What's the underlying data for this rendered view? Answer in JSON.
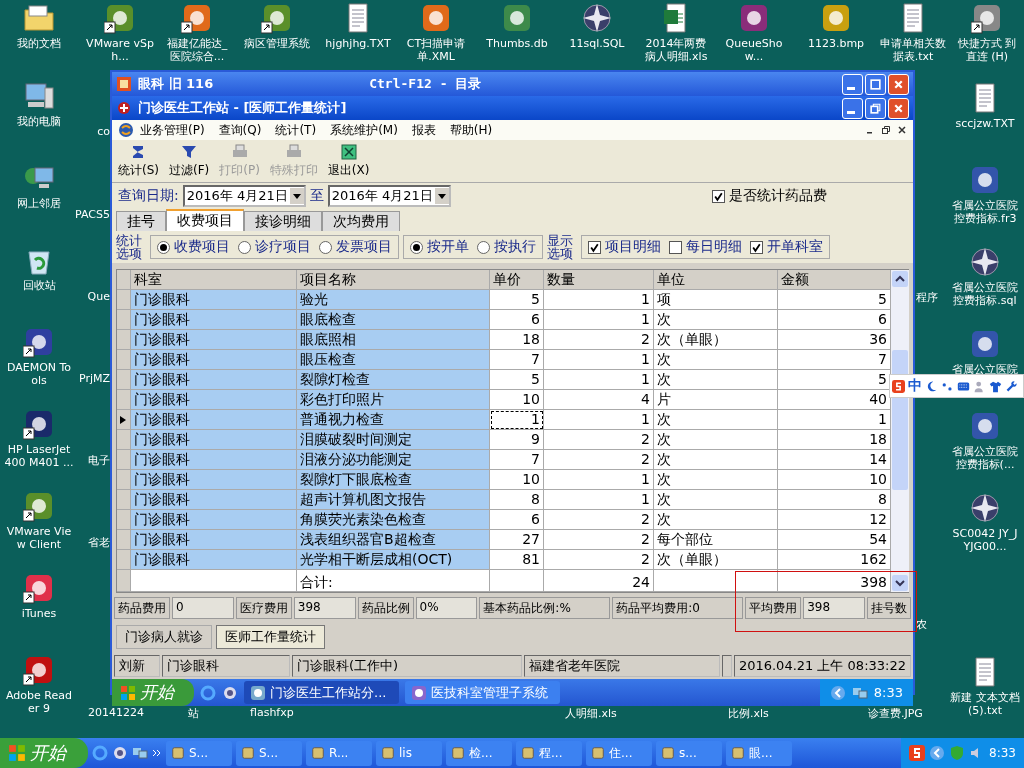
{
  "desktop": {
    "top_icons": [
      {
        "label": "我的文档",
        "kind": "folder",
        "shortcut": false
      },
      {
        "label": "VMware vSph...",
        "kind": "app",
        "shortcut": true
      },
      {
        "label": "福建亿能达_医院综合...",
        "kind": "web",
        "shortcut": true
      },
      {
        "label": "病区管理系统",
        "kind": "app",
        "shortcut": true
      },
      {
        "label": "hjghjhg.TXT",
        "kind": "text",
        "shortcut": false
      },
      {
        "label": "CT扫描申请单.XML",
        "kind": "web",
        "shortcut": false
      },
      {
        "label": "Thumbs.db",
        "kind": "db",
        "shortcut": false
      },
      {
        "label": "11sql.SQL",
        "kind": "compass",
        "shortcut": false
      },
      {
        "label": "2014年两费病人明细.xls",
        "kind": "sheet",
        "shortcut": false
      },
      {
        "label": "QueueShow...",
        "kind": "archive",
        "shortcut": false
      },
      {
        "label": "1123.bmp",
        "kind": "image",
        "shortcut": false
      },
      {
        "label": "申请单相关数据表.txt",
        "kind": "text",
        "shortcut": false
      },
      {
        "label": "快捷方式 到直连 (H)",
        "kind": "drive",
        "shortcut": true
      }
    ],
    "left_icons": [
      {
        "label": "我的电脑",
        "kind": "computer",
        "shortcut": false
      },
      {
        "label": "网上邻居",
        "kind": "network",
        "shortcut": false
      },
      {
        "label": "回收站",
        "kind": "bin",
        "shortcut": false
      },
      {
        "label": "DAEMON Tools",
        "kind": "disc",
        "shortcut": true
      },
      {
        "label": "HP LaserJet 400 M401 ...",
        "kind": "printer",
        "shortcut": true
      },
      {
        "label": "VMware View Client",
        "kind": "app",
        "shortcut": true
      },
      {
        "label": "iTunes",
        "kind": "music",
        "shortcut": true
      },
      {
        "label": "Adobe Reader 9",
        "kind": "pdf",
        "shortcut": true
      }
    ],
    "right_icons": [
      {
        "label": "sccjzw.TXT",
        "kind": "text",
        "shortcut": false
      },
      {
        "label": "省属公立医院控费指标.fr3",
        "kind": "report",
        "shortcut": false
      },
      {
        "label": "省属公立医院控费指标.sql",
        "kind": "compass",
        "shortcut": false
      },
      {
        "label": "省属公立医院",
        "kind": "report",
        "shortcut": false
      },
      {
        "label": "省属公立医院控费指标(...",
        "kind": "report",
        "shortcut": false
      },
      {
        "label": "SC0042 JY_JYJG00...",
        "kind": "compass",
        "shortcut": false
      },
      {
        "label": "新建 文本文档 (5).txt",
        "kind": "text",
        "shortcut": false
      }
    ],
    "covered_labels": [
      "co",
      "PACS5",
      "Que",
      "PrjMZ",
      "电子",
      "省老"
    ],
    "right_fragments": [
      "程序",
      "农"
    ],
    "bottom_labels": [
      "20141224",
      "站",
      "flashfxp",
      "人明细.xls",
      "比例.xls",
      "诊查费.JPG"
    ]
  },
  "window": {
    "title": "眼科 旧 116",
    "hint": "Ctrl-F12 - 目录"
  },
  "child_window": {
    "title": "门诊医生工作站 - [医师工作量统计]"
  },
  "menu": [
    "业务管理(P)",
    "查询(Q)",
    "统计(T)",
    "系统维护(M)",
    "报表",
    "帮助(H)"
  ],
  "toolbar": [
    {
      "label": "统计(S)",
      "kind": "sum",
      "disabled": false
    },
    {
      "label": "过滤(F)",
      "kind": "filter",
      "disabled": false
    },
    {
      "label": "打印(P)",
      "kind": "print",
      "disabled": true
    },
    {
      "label": "特殊打印",
      "kind": "print",
      "disabled": true
    },
    {
      "label": "退出(X)",
      "kind": "exit",
      "disabled": false
    }
  ],
  "query": {
    "label": "查询日期:",
    "from": "2016年 4月21日",
    "to_label": "至",
    "to": "2016年 4月21日",
    "drug_fee": {
      "label": "是否统计药品费",
      "checked": true
    }
  },
  "tabs": [
    {
      "label": "挂号",
      "selected": false
    },
    {
      "label": "收费项目",
      "selected": true
    },
    {
      "label": "接诊明细",
      "selected": false
    },
    {
      "label": "次均费用",
      "selected": false
    }
  ],
  "options": {
    "stat_label": "统计选项",
    "stat": [
      {
        "label": "收费项目",
        "selected": true
      },
      {
        "label": "诊疗项目",
        "selected": false
      },
      {
        "label": "发票项目",
        "selected": false
      }
    ],
    "mode": [
      {
        "label": "按开单",
        "selected": true
      },
      {
        "label": "按执行",
        "selected": false
      }
    ],
    "show_label": "显示选项",
    "show": [
      {
        "label": "项目明细",
        "checked": true
      },
      {
        "label": "每日明细",
        "checked": false
      },
      {
        "label": "开单科室",
        "checked": true
      }
    ]
  },
  "table": {
    "columns": [
      "科室",
      "项目名称",
      "单价",
      "数量",
      "单位",
      "金额"
    ],
    "rows": [
      {
        "cells": [
          "门诊眼科",
          "验光",
          "5",
          "1",
          "项",
          "5"
        ],
        "selected": false
      },
      {
        "cells": [
          "门诊眼科",
          "眼底检查",
          "6",
          "1",
          "次",
          "6"
        ],
        "selected": false
      },
      {
        "cells": [
          "门诊眼科",
          "眼底照相",
          "18",
          "2",
          "次（单眼）",
          "36"
        ],
        "selected": false
      },
      {
        "cells": [
          "门诊眼科",
          "眼压检查",
          "7",
          "1",
          "次",
          "7"
        ],
        "selected": false
      },
      {
        "cells": [
          "门诊眼科",
          "裂隙灯检查",
          "5",
          "1",
          "次",
          "5"
        ],
        "selected": false
      },
      {
        "cells": [
          "门诊眼科",
          "彩色打印照片",
          "10",
          "4",
          "片",
          "40"
        ],
        "selected": false
      },
      {
        "cells": [
          "门诊眼科",
          "普通视力检查",
          "1",
          "1",
          "次",
          "1"
        ],
        "selected": true
      },
      {
        "cells": [
          "门诊眼科",
          "泪膜破裂时间测定",
          "9",
          "2",
          "次",
          "18"
        ],
        "selected": false
      },
      {
        "cells": [
          "门诊眼科",
          "泪液分泌功能测定",
          "7",
          "2",
          "次",
          "14"
        ],
        "selected": false
      },
      {
        "cells": [
          "门诊眼科",
          "裂隙灯下眼底检查",
          "10",
          "1",
          "次",
          "10"
        ],
        "selected": false
      },
      {
        "cells": [
          "门诊眼科",
          "超声计算机图文报告",
          "8",
          "1",
          "次",
          "8"
        ],
        "selected": false
      },
      {
        "cells": [
          "门诊眼科",
          "角膜荧光素染色检查",
          "6",
          "2",
          "次",
          "12"
        ],
        "selected": false
      },
      {
        "cells": [
          "门诊眼科",
          "浅表组织器官B超检查",
          "27",
          "2",
          "每个部位",
          "54"
        ],
        "selected": false
      },
      {
        "cells": [
          "门诊眼科",
          "光学相干断层成相(OCT)",
          "81",
          "2",
          "次（单眼）",
          "162"
        ],
        "selected": false
      }
    ],
    "total": {
      "label": "合计:",
      "quantity": "24",
      "amount": "398"
    }
  },
  "summary": [
    {
      "label": "药品费用",
      "value": "0"
    },
    {
      "label": "医疗费用",
      "value": "398"
    },
    {
      "label": "药品比例",
      "value": "0%"
    },
    {
      "label": "基本药品比例:%"
    },
    {
      "label": "药品平均费用:0"
    },
    {
      "label": "平均费用",
      "value": "398"
    },
    {
      "label": "挂号数"
    }
  ],
  "bottom_tabs": [
    {
      "label": "门诊病人就诊",
      "selected": false
    },
    {
      "label": "医师工作量统计",
      "selected": true
    }
  ],
  "status_bar": {
    "panels": [
      "刘新",
      "门诊眼科",
      "门诊眼科(工作中)",
      "福建省老年医院"
    ],
    "clock": "2016.04.21 上午 08:33:22"
  },
  "inner_taskbar": {
    "start": "开始",
    "tasks": [
      {
        "label": "门诊医生工作站分...",
        "selected": true
      },
      {
        "label": "医技科室管理子系统",
        "selected": false
      }
    ],
    "clock": "8:33"
  },
  "ime_bar": {
    "label": "中"
  },
  "taskbar": {
    "start": "开始",
    "tasks": [
      {
        "label": "S..."
      },
      {
        "label": "S..."
      },
      {
        "label": "R..."
      },
      {
        "label": "lis"
      },
      {
        "label": "检..."
      },
      {
        "label": "程..."
      },
      {
        "label": "住..."
      },
      {
        "label": "s..."
      },
      {
        "label": "眼..."
      }
    ],
    "clock": "8:33"
  }
}
